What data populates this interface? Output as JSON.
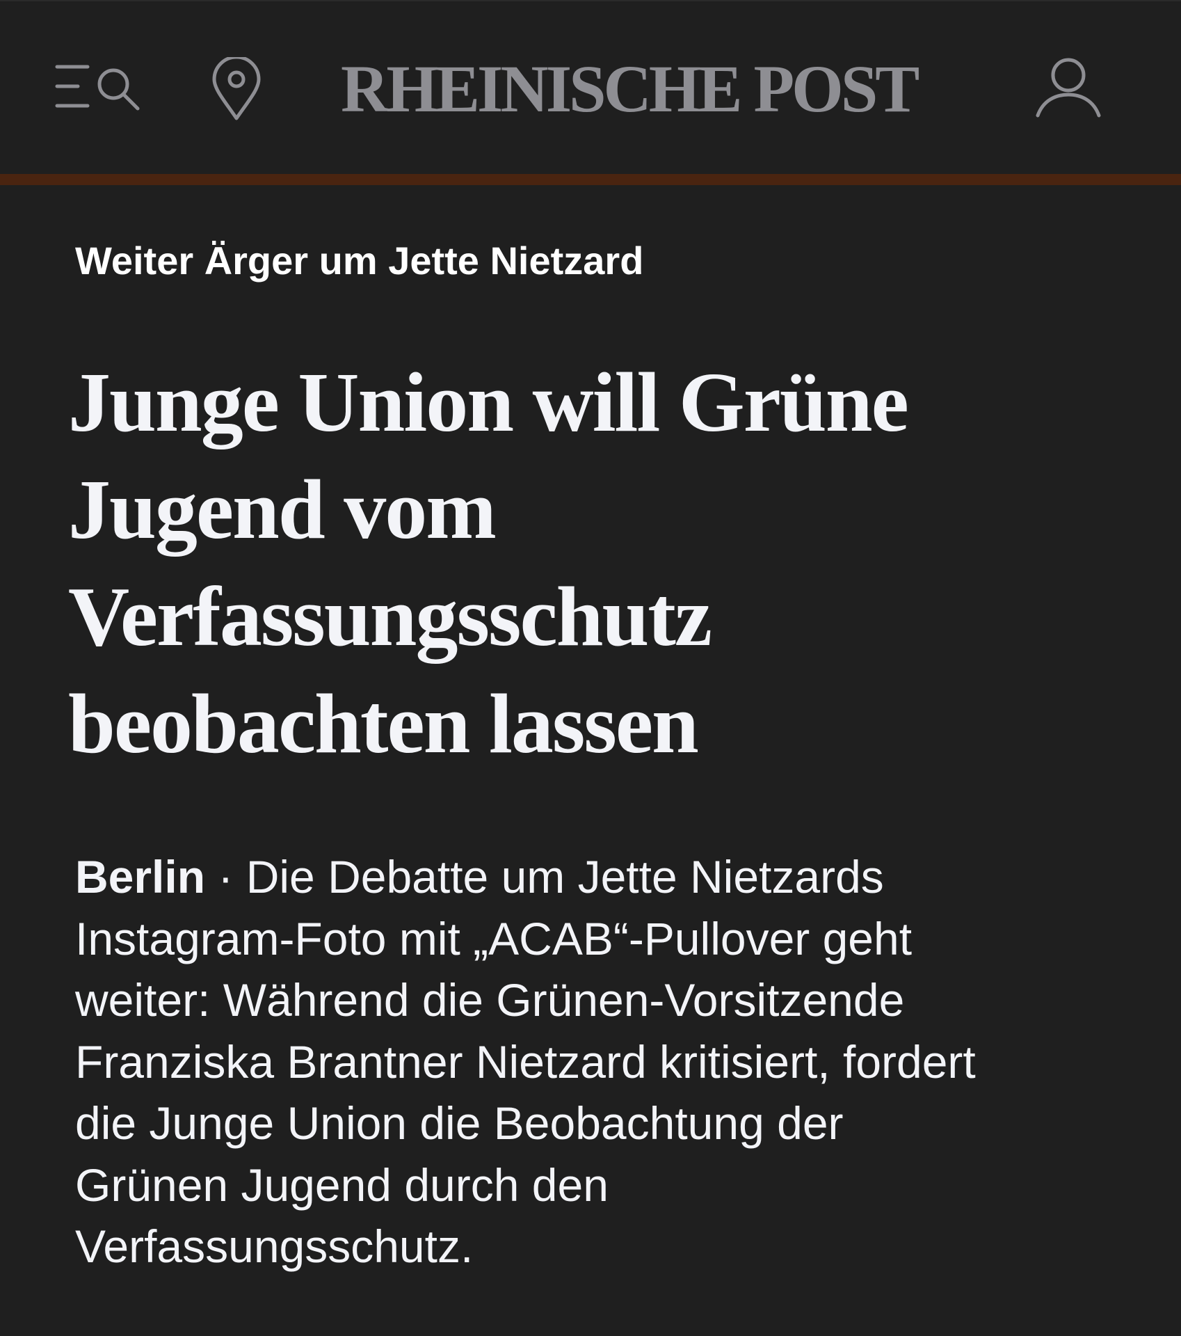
{
  "header": {
    "logo_text": "RHEINISCHE POST",
    "icons": [
      "menu-icon",
      "search-icon",
      "location-pin-icon",
      "user-icon"
    ]
  },
  "article": {
    "kicker": "Weiter Ärger um Jette Nietzard",
    "headline_lines": [
      "Junge Union will Grüne",
      "Jugend vom",
      "Verfassungsschutz",
      "beobachten lassen"
    ],
    "dateline": "Berlin",
    "separator": " · ",
    "lead_lines": [
      "Die Debatte um Jette Nietzards",
      "Instagram-Foto mit „ACAB“-Pullover geht",
      "weiter: Während die Grünen-Vorsitzende",
      "Franziska Brantner Nietzard kritisiert, fordert",
      "die Junge Union die Beobachtung der",
      "Grünen Jugend durch den",
      "Verfassungsschutz."
    ]
  },
  "colors": {
    "background": "#1f1f1f",
    "accent_bar": "#4a2410",
    "logo": "#8e8e93",
    "icons": "#8e8e93",
    "text": "#f3f4f8"
  }
}
